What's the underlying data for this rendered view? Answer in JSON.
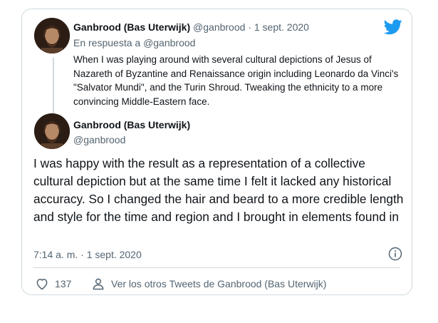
{
  "tweet_parent": {
    "author_name": "Ganbrood (Bas Uterwijk)",
    "author_handle": "@ganbrood",
    "separator": "·",
    "date": "1 sept. 2020",
    "reply_prefix": "En respuesta a",
    "reply_handle": "@ganbrood",
    "text": "When I was playing around with several cultural depictions of Jesus of Nazareth of Byzantine and Renaissance origin including Leonardo da Vinci's \"Salvator Mundi\", and the Turin Shroud. Tweaking the ethnicity to a more convincing Middle-Eastern face."
  },
  "tweet_main": {
    "author_name": "Ganbrood (Bas Uterwijk)",
    "author_handle": "@ganbrood",
    "text": "I was happy with the result as a representation of a collective cultural depiction but at the same time I felt it lacked any historical accuracy. So I changed the hair and beard to a more credible length and style for the time and region and I brought in elements found in",
    "timestamp": "7:14 a. m. · 1 sept. 2020"
  },
  "actions": {
    "like_count": "137",
    "others_link": "Ver los otros Tweets de Ganbrood (Bas Uterwijk)"
  },
  "icons": {
    "brand": "twitter-bird-icon",
    "info": "info-icon",
    "like": "heart-icon",
    "profile": "person-icon"
  },
  "colors": {
    "twitter_blue": "#1d9bf0",
    "text": "#0f1419",
    "muted": "#536471",
    "border": "#cfd9de"
  }
}
